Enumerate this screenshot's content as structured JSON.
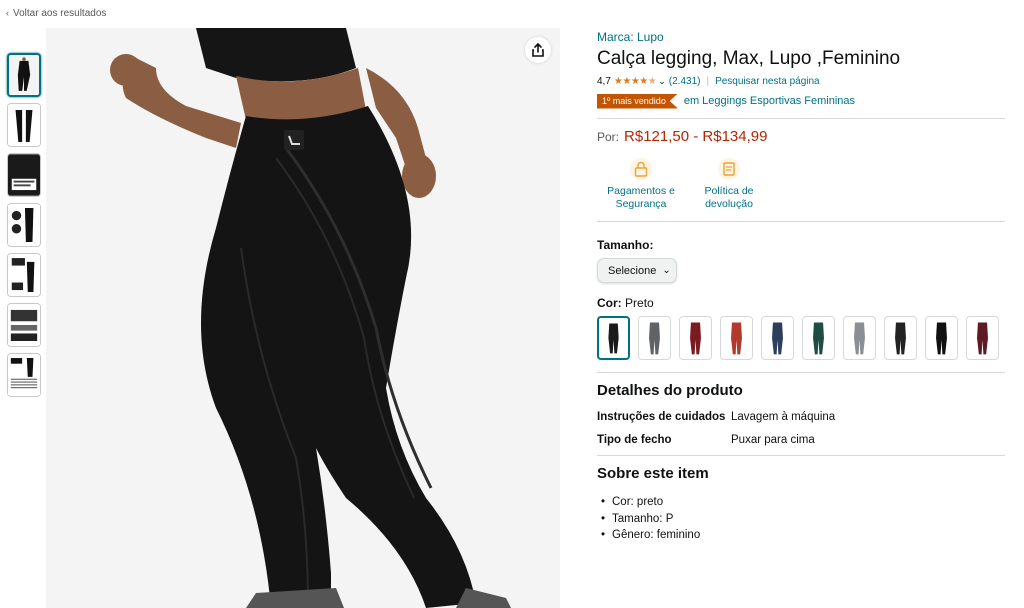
{
  "back": {
    "label": "Voltar aos resultados"
  },
  "product": {
    "brand": "Marca: Lupo",
    "title": "Calça legging, Max, Lupo ,Feminino",
    "rating": "4,7",
    "reviews": "(2.431)",
    "search_page": "Pesquisar nesta página",
    "badge": "1º mais vendido",
    "badge_category": "em Leggings Esportivas Femininas",
    "price_prefix": "Por:",
    "price": "R$121,50 - R$134,99"
  },
  "features": [
    {
      "label": "Pagamentos e Segurança",
      "icon": "lock-icon"
    },
    {
      "label": "Política de devolução",
      "icon": "return-icon"
    }
  ],
  "size": {
    "label": "Tamanho:",
    "select": "Selecione"
  },
  "color": {
    "label": "Cor:",
    "value": "Preto",
    "swatches": [
      {
        "name": "preto",
        "color": "#1a1a1a"
      },
      {
        "name": "cinza-estampado",
        "color": "#5f6368"
      },
      {
        "name": "vinho",
        "color": "#7a1b22"
      },
      {
        "name": "vermelho",
        "color": "#b2392c"
      },
      {
        "name": "azul",
        "color": "#2c3f5c"
      },
      {
        "name": "verde",
        "color": "#1e4d44"
      },
      {
        "name": "cinza",
        "color": "#8a8f96"
      },
      {
        "name": "preto-top",
        "color": "#222222"
      },
      {
        "name": "preto-corda",
        "color": "#111111"
      },
      {
        "name": "bordo",
        "color": "#5e1a24"
      }
    ]
  },
  "details": {
    "title": "Detalhes do produto",
    "rows": [
      {
        "key": "Instruções de cuidados",
        "value": "Lavagem à máquina"
      },
      {
        "key": "Tipo de fecho",
        "value": "Puxar para cima"
      }
    ]
  },
  "about": {
    "title": "Sobre este item",
    "items": [
      "Cor: preto",
      "Tamanho: P",
      "Gênero: feminino"
    ]
  },
  "colors": {
    "link": "#007185",
    "price": "#b12704",
    "badge": "#c45500",
    "stars": "#de7921"
  }
}
